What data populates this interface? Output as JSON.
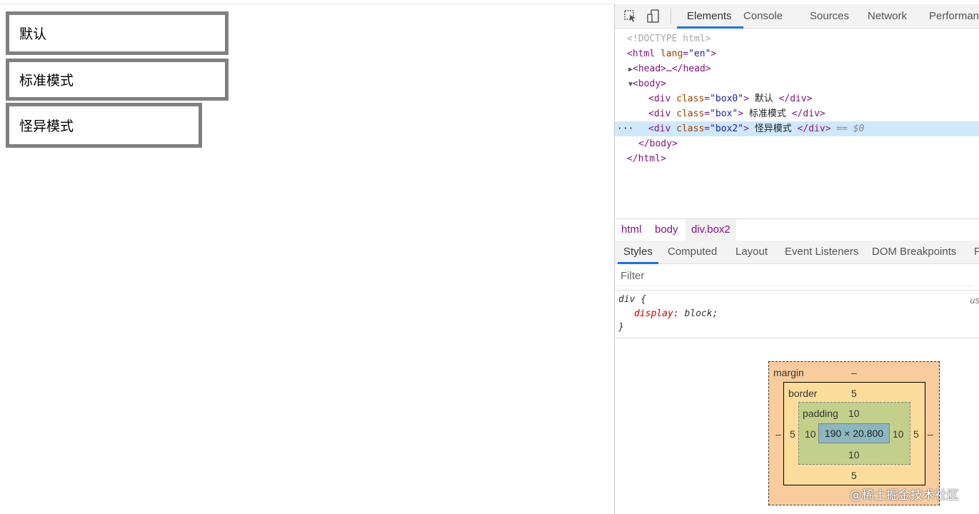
{
  "page": {
    "boxes": [
      {
        "label": "默认"
      },
      {
        "label": "标准模式"
      },
      {
        "label": "怪异模式"
      }
    ]
  },
  "devtools": {
    "tabs": [
      "Elements",
      "Console",
      "Sources",
      "Network",
      "Performan"
    ],
    "active_tab": "Elements",
    "dom": {
      "doctype": "<!DOCTYPE html>",
      "html_open_tag": "<html",
      "html_attr_name": " lang",
      "html_attr_value": "\"en\"",
      "html_open_close": ">",
      "head_line": "<head>…</head>",
      "body_open": "<body>",
      "div_open": "<div",
      "class_attr": " class",
      "eq": "=",
      "box0_class": "\"box0\"",
      "box0_text": " 默认 ",
      "box_class": "\"box\"",
      "box_text": " 标准模式 ",
      "box2_class": "\"box2\"",
      "box2_text": " 怪异模式 ",
      "close_gt": ">",
      "div_close": "</div>",
      "selected_marker": "== $0",
      "dots": "···",
      "body_close": "</body>",
      "html_close": "</html>"
    },
    "breadcrumbs": [
      "html",
      "body",
      "div.box2"
    ],
    "style_tabs": [
      "Styles",
      "Computed",
      "Layout",
      "Event Listeners",
      "DOM Breakpoints",
      "P"
    ],
    "active_style_tab": "Styles",
    "filter_placeholder": "Filter",
    "rule": {
      "selector": "div {",
      "property": "display",
      "value": " block;",
      "close": "}",
      "source": "us"
    },
    "box_model": {
      "margin_label": "margin",
      "margin_top": "–",
      "margin_left": "–",
      "margin_right": "–",
      "border_label": "border",
      "border_top": "5",
      "border_left": "5",
      "border_right": "5",
      "border_bottom": "5",
      "padding_label": "padding",
      "padding_top": "10",
      "padding_left": "10",
      "padding_right": "10",
      "padding_bottom": "10",
      "content": "190 × 20.800"
    }
  },
  "watermark": "@稀土掘金技术社区"
}
